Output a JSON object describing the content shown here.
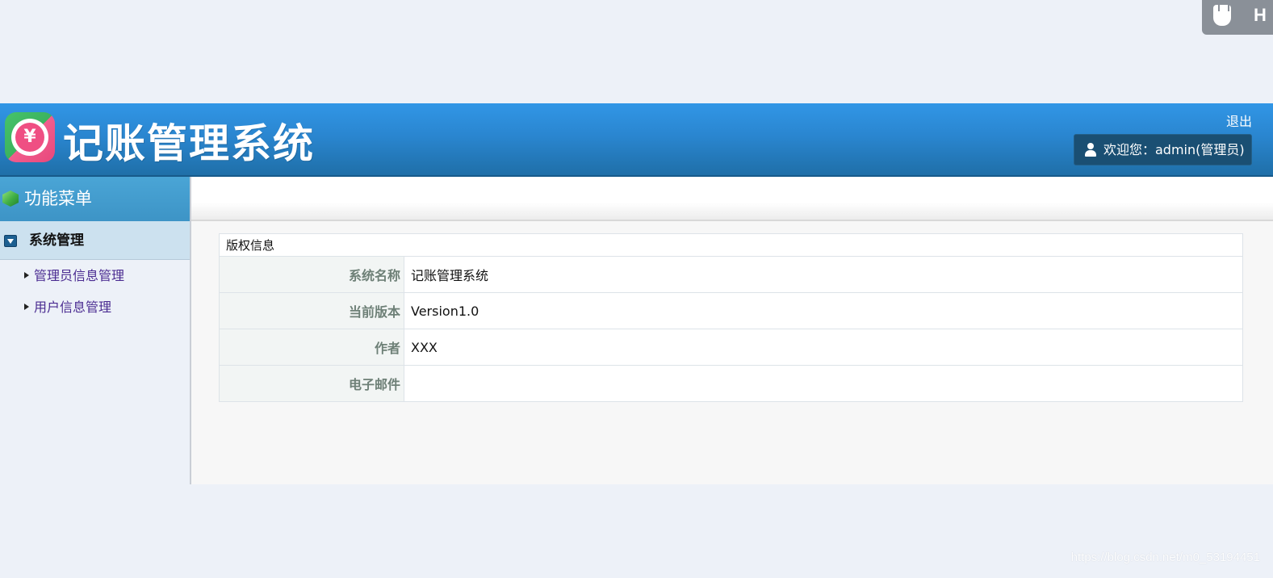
{
  "header": {
    "title": "记账管理系统",
    "logo_symbol": "¥",
    "logout_label": "退出",
    "welcome_text": "欢迎您：admin(管理员)"
  },
  "ext_widget": {
    "icon": "usb-drive-icon",
    "letter": "H"
  },
  "sidebar": {
    "menu_title": "功能菜单",
    "group": {
      "label": "系统管理",
      "items": [
        {
          "label": "管理员信息管理"
        },
        {
          "label": "用户信息管理"
        }
      ]
    }
  },
  "main": {
    "table": {
      "caption": "版权信息",
      "rows": [
        {
          "label": "系统名称",
          "value": "记账管理系统"
        },
        {
          "label": "当前版本",
          "value": "Version1.0"
        },
        {
          "label": "作者",
          "value": "XXX"
        },
        {
          "label": "电子邮件",
          "value": ""
        }
      ]
    }
  },
  "watermark": "https://blog.csdn.net/m0_53194451",
  "colors": {
    "header_blue": "#2a86d0",
    "menu_blue": "#4aa5d6",
    "link_purple": "#4a2b91",
    "page_bg": "#edf1f8"
  }
}
